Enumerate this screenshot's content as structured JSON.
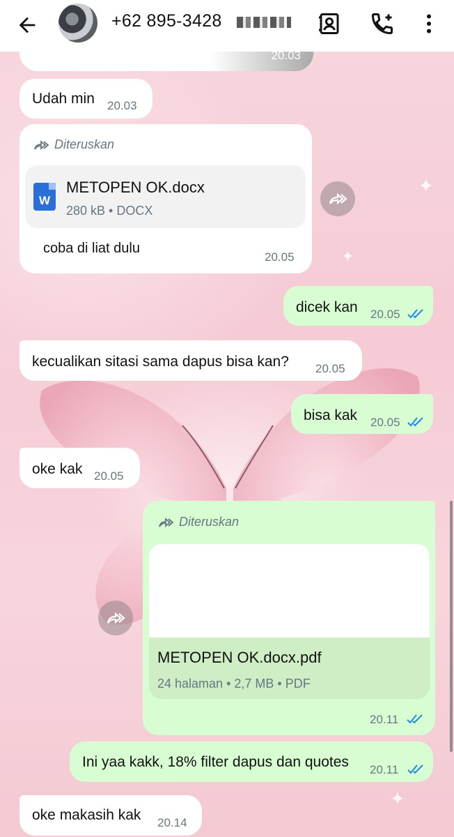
{
  "header": {
    "phone": "+62 895-3428",
    "icons": [
      "back-arrow-icon",
      "avatar",
      "contact-card-icon",
      "add-call-icon",
      "more-vert-icon"
    ]
  },
  "messages": {
    "m0": {
      "time": "20.03"
    },
    "m1": {
      "text": "Udah min",
      "time": "20.03"
    },
    "m2": {
      "forwarded": "Diteruskan",
      "file_name": "METOPEN OK.docx",
      "file_meta": "280 kB • DOCX",
      "file_icon": "W",
      "caption": "coba di liat dulu",
      "time": "20.05"
    },
    "m3": {
      "text": "dicek kan",
      "time": "20.05"
    },
    "m4": {
      "text": "kecualikan sitasi sama dapus bisa kan?",
      "time": "20.05"
    },
    "m5": {
      "text": "bisa kak",
      "time": "20.05"
    },
    "m6": {
      "text": "oke kak",
      "time": "20.05"
    },
    "m7": {
      "forwarded": "Diteruskan",
      "file_name": "METOPEN OK.docx.pdf",
      "file_meta": "24 halaman • 2,7 MB • PDF",
      "time": "20.11"
    },
    "m8": {
      "text": "Ini yaa kakk, 18% filter dapus dan quotes",
      "time": "20.11"
    },
    "m9": {
      "text": "oke makasih kak",
      "time": "20.14"
    }
  },
  "colors": {
    "incoming": "#ffffff",
    "outgoing": "#d9fdd3",
    "read_ticks": "#1e88e5",
    "background": "#f6d3db"
  }
}
